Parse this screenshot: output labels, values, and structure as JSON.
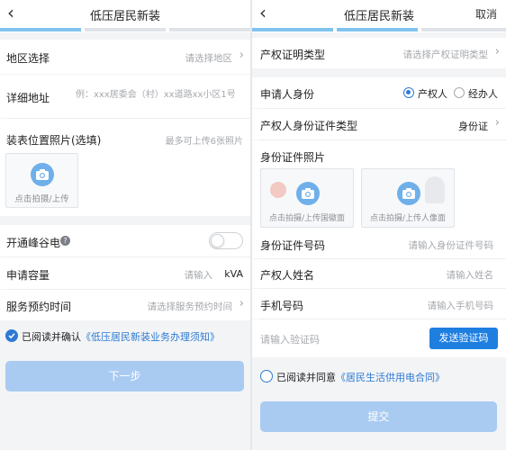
{
  "left": {
    "nav": {
      "back": "‹",
      "title": "低压居民新装"
    },
    "colors": {
      "progress_active": "#7fc3ee",
      "progress_inactive": "#dfe3e8"
    },
    "region": {
      "label": "地区选择",
      "placeholder": "请选择地区"
    },
    "address": {
      "label": "详细地址",
      "placeholder": "例：xxx居委会（村）xx道路xx小区1号"
    },
    "photos": {
      "label": "装表位置照片(选填)",
      "hint": "最多可上传6张照片",
      "upload_text": "点击拍摄/上传"
    },
    "peak": {
      "label": "开通峰谷电",
      "badge": "?"
    },
    "capacity": {
      "label": "申请容量",
      "placeholder": "请输入",
      "unit": "kVA"
    },
    "appointment": {
      "label": "服务预约时间",
      "placeholder": "请选择服务预约时间"
    },
    "agreement": {
      "prefix": "已阅读并确认",
      "link": "《低压居民新装业务办理须知》"
    },
    "next_button": "下一步"
  },
  "right": {
    "nav": {
      "back": "‹",
      "title": "低压居民新装",
      "cancel": "取消"
    },
    "cert_type": {
      "label": "产权证明类型",
      "placeholder": "请选择产权证明类型"
    },
    "identity": {
      "label": "申请人身份",
      "option1": "产权人",
      "option2": "经办人"
    },
    "id_type": {
      "label": "产权人身份证件类型",
      "value": "身份证"
    },
    "id_photo": {
      "label": "身份证件照片",
      "front": "点击拍摄/上传国徽面",
      "back": "点击拍摄/上传人像面"
    },
    "id_number": {
      "label": "身份证件号码",
      "placeholder": "请输入身份证件号码"
    },
    "owner_name": {
      "label": "产权人姓名",
      "placeholder": "请输入姓名"
    },
    "phone": {
      "label": "手机号码",
      "placeholder": "请输入手机号码"
    },
    "code": {
      "placeholder": "请输入验证码",
      "send": "发送验证码"
    },
    "agreement": {
      "prefix": "已阅读并同意",
      "link": "《居民生活供用电合同》"
    },
    "submit_button": "提交"
  }
}
